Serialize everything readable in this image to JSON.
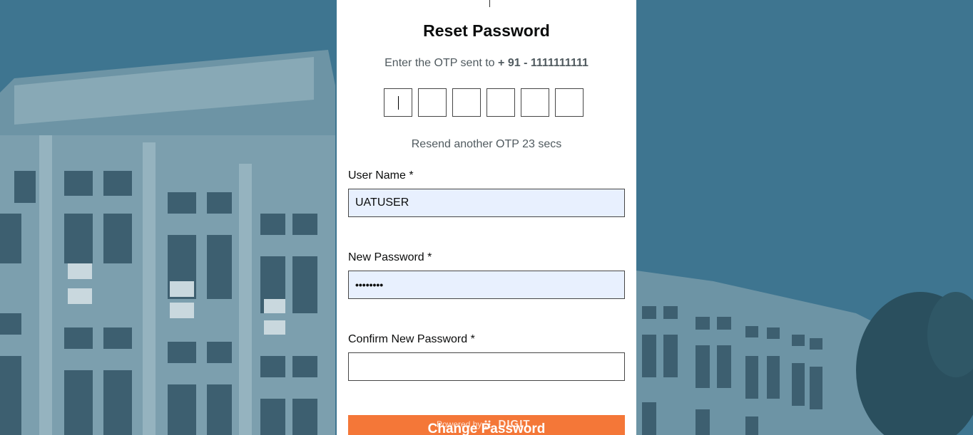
{
  "page": {
    "title": "Reset Password",
    "otp_message_prefix": "Enter the OTP sent to",
    "otp_phone": "+ 91 - 1111111111",
    "otp_digits": [
      "",
      "",
      "",
      "",
      "",
      ""
    ],
    "resend_text": "Resend another OTP 23 secs"
  },
  "form": {
    "username_label": "User Name *",
    "username_value": "UATUSER",
    "new_password_label": "New Password *",
    "new_password_value": "••••••••",
    "confirm_password_label": "Confirm New Password *",
    "confirm_password_value": "",
    "submit_label": "Change Password"
  },
  "footer": {
    "powered_by": "Powered by",
    "brand_icon": "digit-logo-icon",
    "brand": "DIGIT"
  },
  "colors": {
    "background": "#3e7590",
    "accent": "#f47738",
    "autofill": "#e8f0fe"
  }
}
